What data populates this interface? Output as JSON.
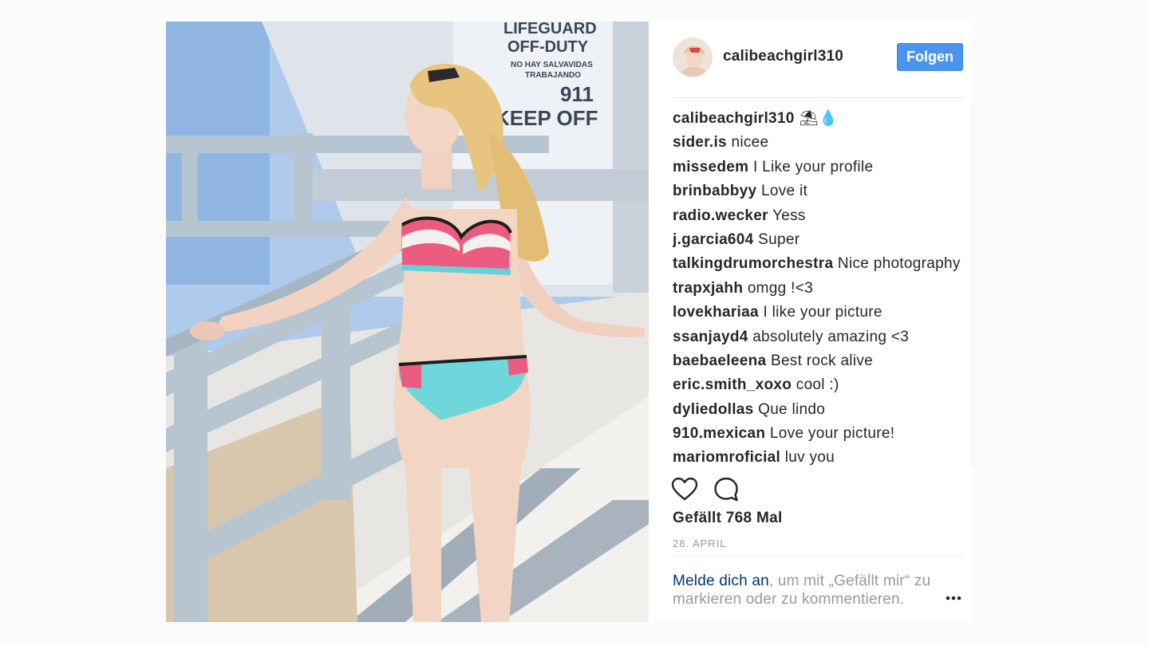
{
  "post": {
    "photo_alt": "beach lifeguard tower photo",
    "sign_lines": [
      "LIFEGUARD",
      "OFF-DUTY",
      "NO HAY SALVAVIDAS",
      "TRABAJANDO",
      "911",
      "KEEP OFF"
    ]
  },
  "header": {
    "username": "calibeachgirl310",
    "follow_label": "Folgen"
  },
  "caption": {
    "username": "calibeachgirl310",
    "emoji": "⛱💧"
  },
  "comments": [
    {
      "user": "sider.is",
      "text": "nicee"
    },
    {
      "user": "missedem",
      "text": "I Like your profile"
    },
    {
      "user": "brinbabbyy",
      "text": "Love it"
    },
    {
      "user": "radio.wecker",
      "text": "Yess"
    },
    {
      "user": "j.garcia604",
      "text": "Super"
    },
    {
      "user": "talkingdrumorchestra",
      "text": "Nice photography"
    },
    {
      "user": "trapxjahh",
      "text": "omgg !<3"
    },
    {
      "user": "lovekhariaa",
      "text": "I like your picture"
    },
    {
      "user": "ssanjayd4",
      "text": "absolutely amazing <3"
    },
    {
      "user": "baebaeleena",
      "text": "Best rock alive"
    },
    {
      "user": "eric.smith_xoxo",
      "text": "cool :)"
    },
    {
      "user": "dyliedollas",
      "text": "Que lindo"
    },
    {
      "user": "910.mexican",
      "text": "Love your picture!"
    },
    {
      "user": "mariomroficial",
      "text": "luv you"
    }
  ],
  "actions": {
    "like_icon": "heart-icon",
    "comment_icon": "comment-icon"
  },
  "likes_text": "Gefällt 768 Mal",
  "date_text": "28. APRIL",
  "login": {
    "link": "Melde dich an",
    "rest": ", um mit „Gefällt mir“ zu markieren oder zu kommentieren."
  },
  "colors": {
    "follow_button": "#4a94ee",
    "link": "#003569",
    "muted": "#999999"
  }
}
